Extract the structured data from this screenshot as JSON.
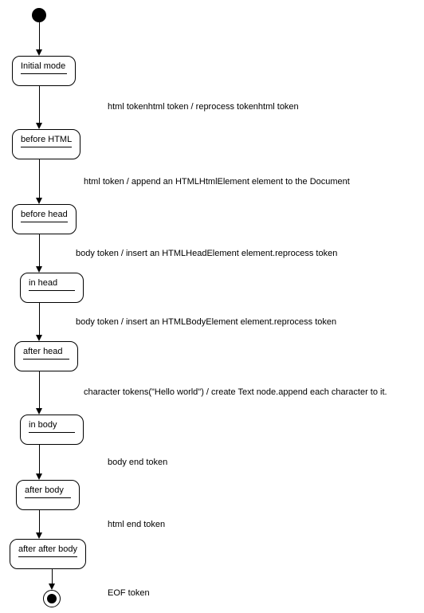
{
  "states": {
    "initial": "Initial mode",
    "beforeHtml": "before HTML",
    "beforeHead": "before head",
    "inHead": "in head",
    "afterHead": "after head",
    "inBody": "in body",
    "afterBody": "after body",
    "afterAfterBody": "after after body"
  },
  "transitions": {
    "t1": "html tokenhtml token / reprocess tokenhtml token",
    "t2": "html token / append an HTMLHtmlElement element to the Document",
    "t3": "body token / insert an HTMLHeadElement element.reprocess token",
    "t4": "body token / insert an HTMLBodyElement element.reprocess token",
    "t5": "character tokens(\"Hello world\") / create Text node.append each character to it.",
    "t6": "body end token",
    "t7": "html end token",
    "t8": "EOF token"
  }
}
